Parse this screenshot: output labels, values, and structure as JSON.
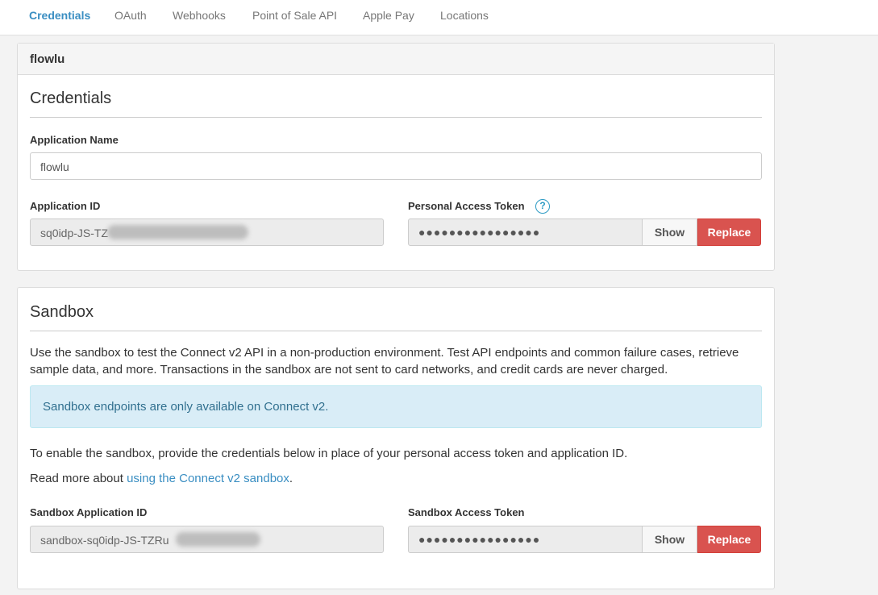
{
  "nav": {
    "tabs": [
      {
        "label": "Credentials",
        "active": true
      },
      {
        "label": "OAuth",
        "active": false
      },
      {
        "label": "Webhooks",
        "active": false
      },
      {
        "label": "Point of Sale API",
        "active": false
      },
      {
        "label": "Apple Pay",
        "active": false
      },
      {
        "label": "Locations",
        "active": false
      }
    ]
  },
  "app": {
    "header_title": "flowlu"
  },
  "credentials": {
    "title": "Credentials",
    "app_name_label": "Application Name",
    "app_name_value": "flowlu",
    "app_id_label": "Application ID",
    "app_id_value": "sq0idp-JS-TZ",
    "token_label": "Personal Access Token",
    "token_mask": "●●●●●●●●●●●●●●●●",
    "help_glyph": "?",
    "show_label": "Show",
    "replace_label": "Replace"
  },
  "sandbox": {
    "title": "Sandbox",
    "description": "Use the sandbox to test the Connect v2 API in a non-production environment. Test API endpoints and common failure cases, retrieve sample data, and more. Transactions in the sandbox are not sent to card networks, and credit cards are never charged.",
    "alert_text": "Sandbox endpoints are only available on Connect v2.",
    "enable_text": "To enable the sandbox, provide the credentials below in place of your personal access token and application ID.",
    "read_more_prefix": "Read more about ",
    "read_more_link": "using the Connect v2 sandbox",
    "read_more_suffix": ".",
    "app_id_label": "Sandbox Application ID",
    "app_id_value": "sandbox-sq0idp-JS-TZRu",
    "token_label": "Sandbox Access Token",
    "token_mask": "●●●●●●●●●●●●●●●●",
    "show_label": "Show",
    "replace_label": "Replace"
  },
  "colors": {
    "accent": "#3a8ec2",
    "danger": "#d9534f",
    "info_bg": "#d9edf7",
    "info_text": "#31708f"
  }
}
